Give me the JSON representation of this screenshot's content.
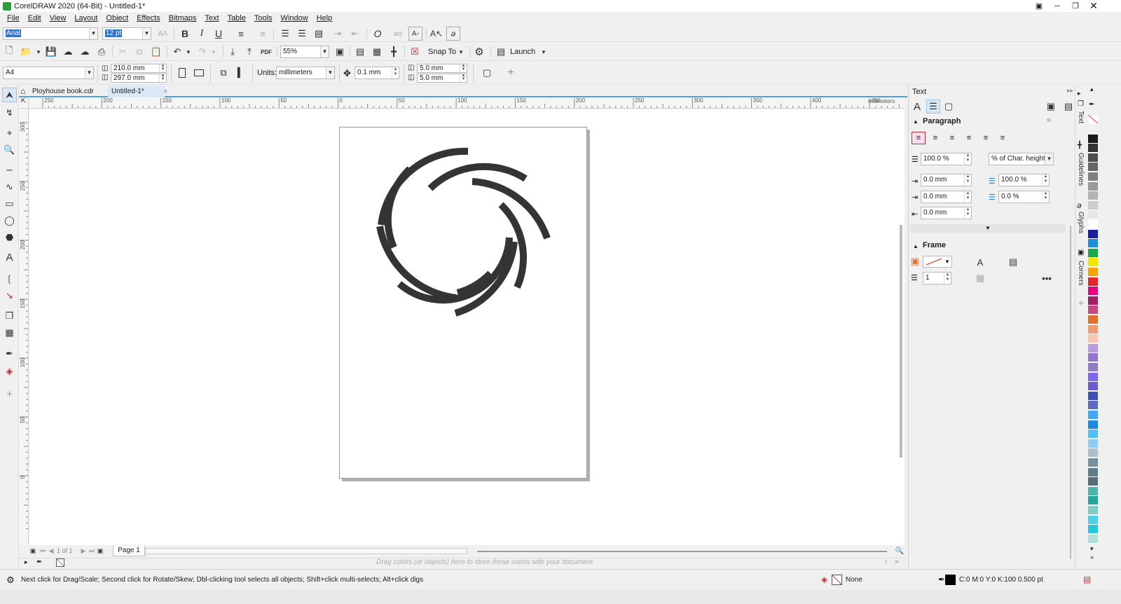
{
  "app": {
    "title": "CorelDRAW 2020 (64-Bit) - Untitled-1*"
  },
  "menu": [
    "File",
    "Edit",
    "View",
    "Layout",
    "Object",
    "Effects",
    "Bitmaps",
    "Text",
    "Table",
    "Tools",
    "Window",
    "Help"
  ],
  "text_toolbar": {
    "font": "Arial",
    "size": "12 pt"
  },
  "standard_toolbar": {
    "zoom": "55%",
    "snap_to": "Snap To",
    "launch": "Launch"
  },
  "property_bar": {
    "page_size": "A4",
    "width": "210.0 mm",
    "height": "297.0 mm",
    "units_label": "Units:",
    "units": "millimeters",
    "nudge": "0.1 mm",
    "dup_x": "5.0 mm",
    "dup_y": "5.0 mm"
  },
  "doc_tabs": [
    {
      "label": "Ployhouse book.cdr",
      "active": false
    },
    {
      "label": "Untitled-1*",
      "active": true
    }
  ],
  "hruler": {
    "labels": [
      "250",
      "200",
      "150",
      "100",
      "50",
      "0",
      "50",
      "100",
      "150",
      "200",
      "250",
      "300",
      "350",
      "400",
      "450"
    ],
    "unit": "millimeters"
  },
  "vruler": {
    "labels": [
      "300",
      "250",
      "200",
      "150",
      "100",
      "50",
      "0"
    ]
  },
  "page_nav": {
    "of_text": "1 of 1",
    "page_tab": "Page 1"
  },
  "palette_hint": "Drag colors (or objects) here to store these colors with your document",
  "status": {
    "hint": "Next click for Drag/Scale; Second click for Rotate/Skew; Dbl-clicking tool selects all objects; Shift+click multi-selects; Alt+click digs",
    "fill": "None",
    "outline": "C:0 M:0 Y:0 K:100  0.500 pt"
  },
  "docker": {
    "title": "Text",
    "paragraph": {
      "header": "Paragraph",
      "line_spacing": "100.0 %",
      "spacing_unit": "% of Char. height",
      "left_indent": "0.0 mm",
      "before_paragraph": "100.0 %",
      "first_line": "0.0 mm",
      "after_paragraph": "0.0 %",
      "right_indent": "0.0 mm"
    },
    "frame": {
      "header": "Frame",
      "columns": "1"
    }
  },
  "docker_tabs": [
    "Text",
    "Guidelines",
    "Glyphs",
    "Corners"
  ],
  "palette_colors": [
    "#ffffff",
    "#1a1a1a",
    "#333333",
    "#4d4d4d",
    "#666666",
    "#808080",
    "#999999",
    "#b3b3b3",
    "#cccccc",
    "#e6e6e6",
    "#ffffff",
    "#1c1c9e",
    "#1e8fd6",
    "#1aa84b",
    "#f2e600",
    "#f7a400",
    "#e8232a",
    "#e6007e",
    "#9e1f63",
    "#c4497f",
    "#e36e2d",
    "#f39a74",
    "#f9c6b0",
    "#b39ddb",
    "#9575cd",
    "#8e7cc3",
    "#7b68ee",
    "#6a5acd",
    "#3f51b5",
    "#5c6bc0",
    "#42a5f5",
    "#1e88e5",
    "#4fc3f7",
    "#90caf9",
    "#b0bec5",
    "#78909c",
    "#607d8b",
    "#546e7a",
    "#4db6ac",
    "#26a69a",
    "#80cbc4",
    "#4dd0e1",
    "#26c6da",
    "#b2dfdb"
  ]
}
